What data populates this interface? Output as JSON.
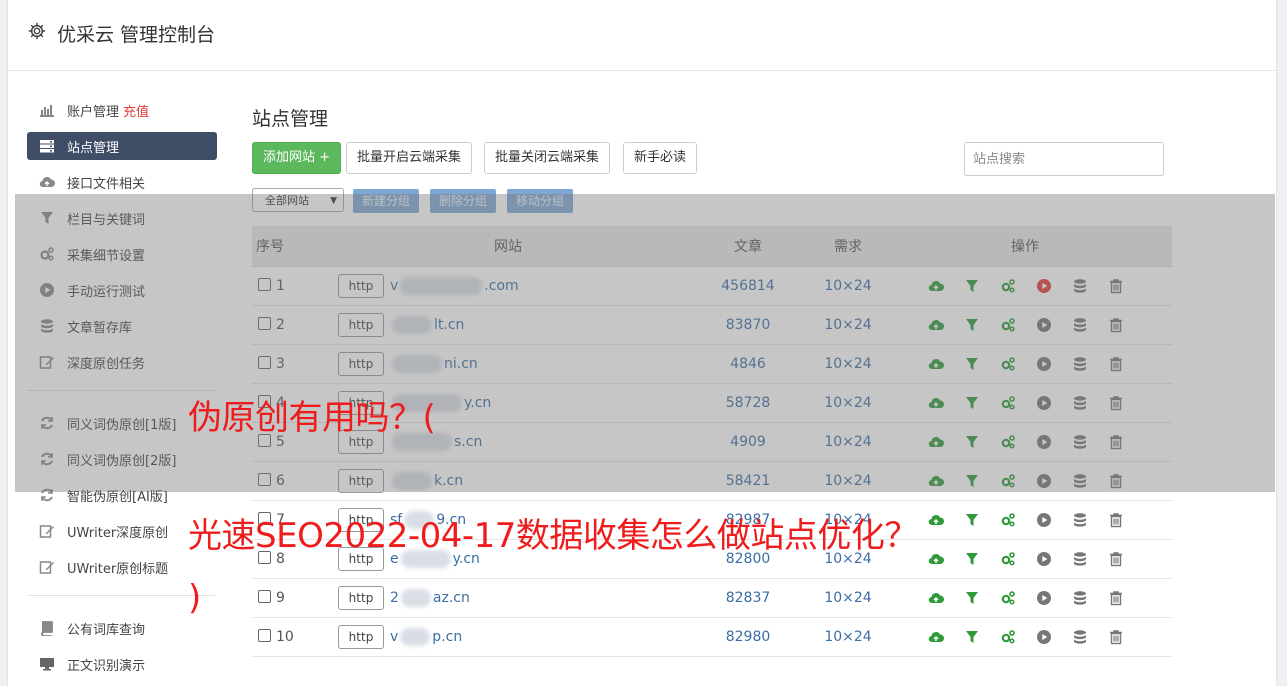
{
  "header": {
    "title": "优采云 管理控制台",
    "icon": "gear-icon"
  },
  "sidebar": {
    "group1": [
      {
        "label": "账户管理",
        "extra": "充值",
        "icon": "bar-chart-icon"
      },
      {
        "label": "站点管理",
        "icon": "server-icon",
        "active": true
      },
      {
        "label": "接口文件相关",
        "icon": "cloud-upload-icon"
      },
      {
        "label": "栏目与关键词",
        "icon": "filter-icon"
      },
      {
        "label": "采集细节设置",
        "icon": "gears-icon"
      },
      {
        "label": "手动运行测试",
        "icon": "play-circle-icon"
      },
      {
        "label": "文章暂存库",
        "icon": "database-icon"
      },
      {
        "label": "深度原创任务",
        "icon": "edit-icon"
      }
    ],
    "group2": [
      {
        "label": "同义词伪原创[1版]",
        "icon": "refresh-icon"
      },
      {
        "label": "同义词伪原创[2版]",
        "icon": "refresh-icon"
      },
      {
        "label": "智能伪原创[AI版]",
        "icon": "refresh-icon"
      },
      {
        "label": "UWriter深度原创",
        "icon": "edit-icon"
      },
      {
        "label": "UWriter原创标题",
        "icon": "edit-icon"
      }
    ],
    "group3": [
      {
        "label": "公有词库查询",
        "icon": "book-icon"
      },
      {
        "label": "正文识别演示",
        "icon": "monitor-icon"
      }
    ]
  },
  "main": {
    "title": "站点管理",
    "toolbar": {
      "add_site": "添加网站 +",
      "batch_on": "批量开启云端采集",
      "batch_off": "批量关闭云端采集",
      "newbie": "新手必读",
      "search_placeholder": "站点搜索"
    },
    "filter": {
      "group_select": "全部网站",
      "new_group": "新建分组",
      "delete_group": "删除分组",
      "move_group": "移动分组"
    },
    "table": {
      "headers": {
        "no": "序号",
        "site": "网站",
        "articles": "文章",
        "demand": "需求",
        "ops": "操作"
      },
      "rows": [
        {
          "no": "1",
          "prefix": "http",
          "domain_head": "v",
          "domain_tail": ".com",
          "articles": "456814",
          "demand": "10×24",
          "running": true
        },
        {
          "no": "2",
          "prefix": "http",
          "domain_head": "",
          "domain_tail": "lt.cn",
          "articles": "83870",
          "demand": "10×24",
          "running": false
        },
        {
          "no": "3",
          "prefix": "http",
          "domain_head": "",
          "domain_tail": "ni.cn",
          "articles": "4846",
          "demand": "10×24",
          "running": false
        },
        {
          "no": "4",
          "prefix": "http",
          "domain_head": "",
          "domain_tail": "y.cn",
          "articles": "58728",
          "demand": "10×24",
          "running": false
        },
        {
          "no": "5",
          "prefix": "http",
          "domain_head": "",
          "domain_tail": "s.cn",
          "articles": "4909",
          "demand": "10×24",
          "running": false
        },
        {
          "no": "6",
          "prefix": "http",
          "domain_head": "",
          "domain_tail": "k.cn",
          "articles": "58421",
          "demand": "10×24",
          "running": false
        },
        {
          "no": "7",
          "prefix": "http",
          "domain_head": "sf",
          "domain_tail": "9.cn",
          "articles": "82987",
          "demand": "10×24",
          "running": false
        },
        {
          "no": "8",
          "prefix": "http",
          "domain_head": "e",
          "domain_tail": "y.cn",
          "articles": "82800",
          "demand": "10×24",
          "running": false
        },
        {
          "no": "9",
          "prefix": "http",
          "domain_head": "2",
          "domain_tail": "az.cn",
          "articles": "82837",
          "demand": "10×24",
          "running": false
        },
        {
          "no": "10",
          "prefix": "http",
          "domain_head": "v",
          "domain_tail": "p.cn",
          "articles": "82980",
          "demand": "10×24",
          "running": false
        }
      ]
    }
  },
  "overlay_caption": {
    "line1": "伪原创有用吗？(",
    "line2": "光速SEO2022-04-17数据收集怎么做站点优化？",
    "line3": ")"
  },
  "colors": {
    "accent_green": "#5cb85c",
    "sidebar_active": "#3f4e66",
    "link_blue": "#3a6ea5",
    "caption_red": "#ee1c1c",
    "icon_green": "#2e9a3a",
    "play_red": "#e53935"
  }
}
